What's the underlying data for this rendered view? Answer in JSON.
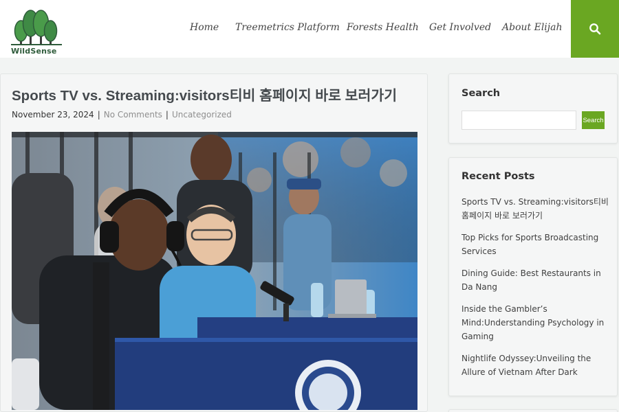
{
  "site": {
    "logo_text": "WildSense",
    "colors": {
      "accent": "#6aa722",
      "logo_tree": "#4a9b4a",
      "logo_text": "#2e5b3a"
    }
  },
  "nav": {
    "items": [
      {
        "label": "Home"
      },
      {
        "label": "Treemetrics Platform"
      },
      {
        "label": "Forests Health"
      },
      {
        "label": "Get Involved"
      },
      {
        "label": "About Elijah"
      }
    ],
    "search_icon": "search-icon"
  },
  "post": {
    "title": "Sports TV vs. Streaming:visitors티비 홈페이지 바로 보러가기",
    "date": "November 23, 2024",
    "separator": "|",
    "comments": "No Comments",
    "category": "Uncategorized",
    "image_icon": "sports-broadcast-photo"
  },
  "sidebar": {
    "search": {
      "title": "Search",
      "input_value": "",
      "button_label": "Search"
    },
    "recent": {
      "title": "Recent Posts",
      "items": [
        {
          "label": "Sports TV vs. Streaming:visitors티비 홈페이지 바로 보러가기"
        },
        {
          "label": "Top Picks for Sports Broadcasting Services"
        },
        {
          "label": "Dining Guide: Best Restaurants in Da Nang"
        },
        {
          "label": "Inside the Gambler’s Mind:Understanding Psychology in Gaming"
        },
        {
          "label": "Nightlife Odyssey:Unveiling the Allure of Vietnam After Dark"
        }
      ]
    }
  }
}
